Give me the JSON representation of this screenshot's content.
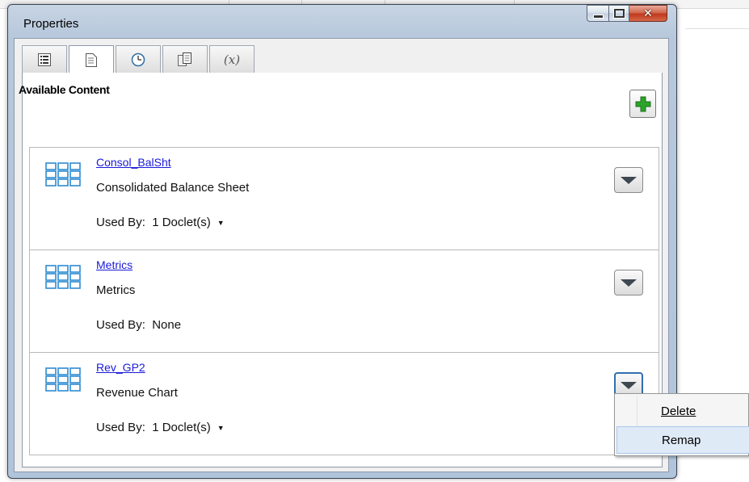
{
  "window": {
    "title": "Properties"
  },
  "tabs": [
    {
      "name": "list-icon"
    },
    {
      "name": "document-icon"
    },
    {
      "name": "clock-icon"
    },
    {
      "name": "copy-document-icon"
    },
    {
      "name": "variable-icon",
      "label": "(x)"
    }
  ],
  "section": {
    "title": "Available Content"
  },
  "items": [
    {
      "link": "Consol_BalSht",
      "desc": "Consolidated Balance Sheet",
      "used_by_label": "Used By:",
      "used_by_value": "1 Doclet(s)",
      "has_dropdown": true
    },
    {
      "link": "Metrics",
      "desc": "Metrics",
      "used_by_label": "Used By:",
      "used_by_value": "None",
      "has_dropdown": false
    },
    {
      "link": "Rev_GP2",
      "desc": "Revenue Chart",
      "used_by_label": "Used By:",
      "used_by_value": "1 Doclet(s)",
      "has_dropdown": true
    }
  ],
  "context_menu": {
    "items": [
      "Delete",
      "Remap"
    ],
    "hovered": "Remap"
  },
  "colors": {
    "link": "#1a1ad8",
    "icon_blue": "#2e8bd0",
    "add_green": "#2aa42a",
    "close_red": "#c0391c"
  }
}
